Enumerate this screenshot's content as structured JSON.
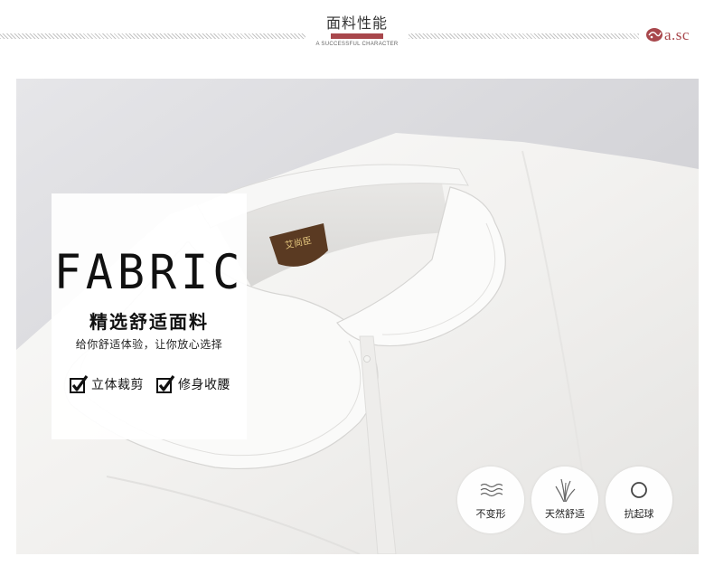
{
  "header": {
    "title": "面料性能",
    "subtitle": "A SUCCESSFUL CHARACTER",
    "brand": "a.sc"
  },
  "card": {
    "title": "FABRIC",
    "subtitle": "精选舒适面料",
    "description": "给你舒适体验，让你放心选择",
    "features": [
      {
        "label": "立体裁剪",
        "icon": "checkbox-checked-icon"
      },
      {
        "label": "修身收腰",
        "icon": "checkbox-checked-icon"
      }
    ]
  },
  "properties": [
    {
      "label": "不变形",
      "icon": "waves-icon"
    },
    {
      "label": "天然舒适",
      "icon": "grass-icon"
    },
    {
      "label": "抗起球",
      "icon": "circle-icon"
    }
  ],
  "colors": {
    "accent": "#a8474c",
    "background": "#ffffff",
    "photo_backdrop": "#d9d9dc",
    "shirt": "#f4f3f1",
    "label_tag": "#5a3a22"
  }
}
